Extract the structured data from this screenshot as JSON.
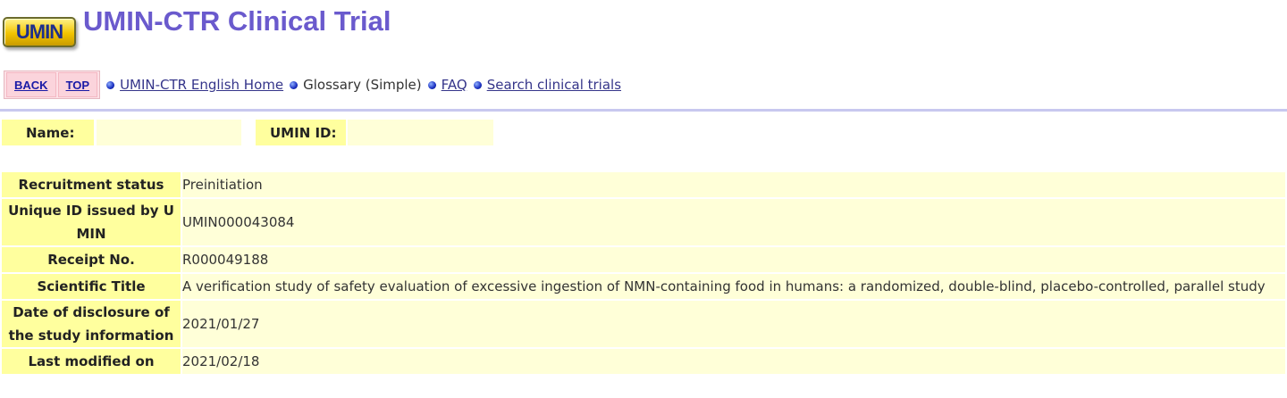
{
  "header": {
    "logo_text": "UMIN",
    "title": "UMIN-CTR Clinical Trial"
  },
  "nav": {
    "back_label": "BACK",
    "top_label": "TOP",
    "links": [
      {
        "label": "UMIN-CTR English Home",
        "link": true
      },
      {
        "label": "Glossary (Simple)",
        "link": false
      },
      {
        "label": "FAQ",
        "link": true
      },
      {
        "label": "Search clinical trials",
        "link": true
      }
    ]
  },
  "idrow": {
    "name_label": "Name:",
    "name_value": "",
    "umin_id_label": "UMIN ID:",
    "umin_id_value": ""
  },
  "trial": {
    "rows": [
      {
        "label": "Recruitment status",
        "value": "Preinitiation"
      },
      {
        "label": "Unique ID issued by UMIN",
        "value": "UMIN000043084"
      },
      {
        "label": "Receipt No.",
        "value": "R000049188"
      },
      {
        "label": "Scientific Title",
        "value": "A verification study of safety evaluation of excessive ingestion of NMN-containing food in humans: a randomized, double-blind, placebo-controlled, parallel study"
      },
      {
        "label": "Date of disclosure of the study information",
        "value": "2021/01/27"
      },
      {
        "label": "Last modified on",
        "value": "2021/02/18"
      }
    ]
  },
  "colors": {
    "title": "#6a5acd",
    "label_bg": "#ffff9e",
    "value_bg": "#ffffd8",
    "nav_button_bg": "#fbd4dc",
    "divider": "#c8c8ef"
  },
  "icons": {
    "nav_bullet": "blue-bullet-icon"
  }
}
